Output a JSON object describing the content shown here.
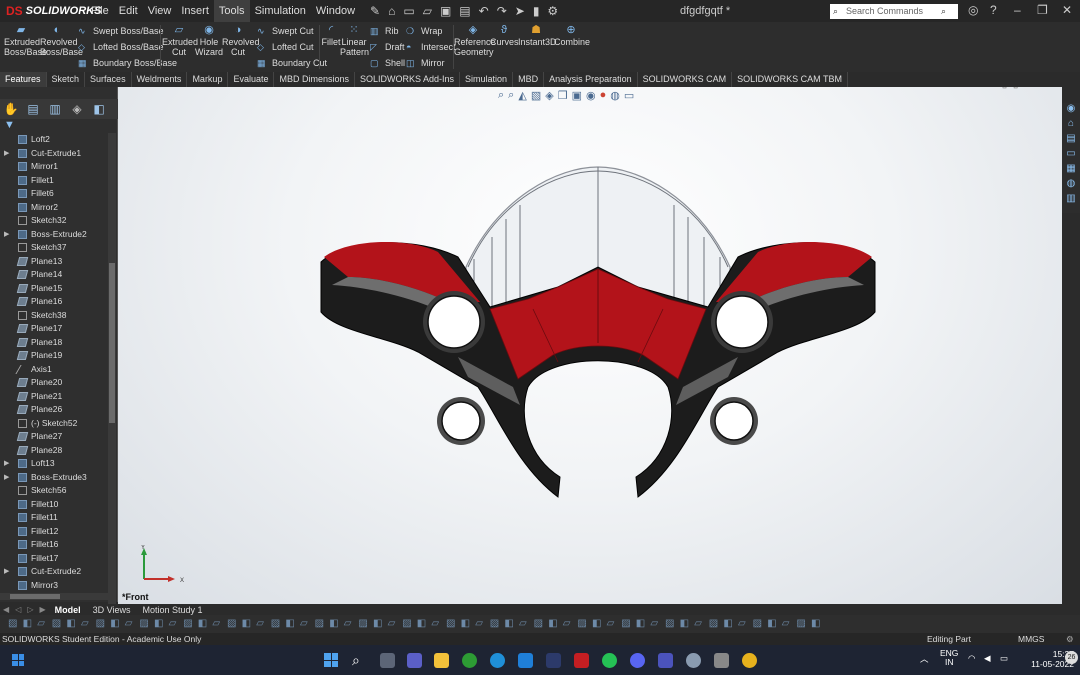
{
  "app": {
    "brand": "SOLIDWORKS",
    "brand_mark": "DS",
    "doc_title": "dfgdfgqtf *"
  },
  "menu": [
    "File",
    "Edit",
    "View",
    "Insert",
    "Tools",
    "Simulation",
    "Window"
  ],
  "search": {
    "placeholder": "Search Commands"
  },
  "cmd": {
    "extruded_boss": "Extruded Boss/Base",
    "revolved_boss": "Revolved Boss/Base",
    "swept_boss": "Swept Boss/Base",
    "lofted_boss": "Lofted Boss/Base",
    "boundary_boss": "Boundary Boss/Base",
    "extruded_cut": "Extruded Cut",
    "hole_wizard": "Hole Wizard",
    "revolved_cut": "Revolved Cut",
    "swept_cut": "Swept Cut",
    "lofted_cut": "Lofted Cut",
    "boundary_cut": "Boundary Cut",
    "fillet": "Fillet",
    "linear_pattern": "Linear Pattern",
    "rib": "Rib",
    "draft": "Draft",
    "shell": "Shell",
    "wrap": "Wrap",
    "intersect": "Intersect",
    "mirror": "Mirror",
    "reference_geometry": "Reference Geometry",
    "curves": "Curves",
    "instant3d": "Instant3D",
    "combine": "Combine"
  },
  "tabs": [
    "Features",
    "Sketch",
    "Surfaces",
    "Weldments",
    "Markup",
    "Evaluate",
    "MBD Dimensions",
    "SOLIDWORKS Add-Ins",
    "Simulation",
    "MBD",
    "Analysis Preparation",
    "SOLIDWORKS CAM",
    "SOLIDWORKS CAM TBM"
  ],
  "tree": [
    {
      "label": "Loft2",
      "expand": false,
      "kind": "feat"
    },
    {
      "label": "Cut-Extrude1",
      "expand": true,
      "kind": "feat"
    },
    {
      "label": "Mirror1",
      "expand": false,
      "kind": "feat"
    },
    {
      "label": "Fillet1",
      "expand": false,
      "kind": "feat"
    },
    {
      "label": "Fillet6",
      "expand": false,
      "kind": "feat"
    },
    {
      "label": "Mirror2",
      "expand": false,
      "kind": "feat"
    },
    {
      "label": "Sketch32",
      "expand": false,
      "kind": "sketch"
    },
    {
      "label": "Boss-Extrude2",
      "expand": true,
      "kind": "feat"
    },
    {
      "label": "Sketch37",
      "expand": false,
      "kind": "sketch"
    },
    {
      "label": "Plane13",
      "expand": false,
      "kind": "plane"
    },
    {
      "label": "Plane14",
      "expand": false,
      "kind": "plane"
    },
    {
      "label": "Plane15",
      "expand": false,
      "kind": "plane"
    },
    {
      "label": "Plane16",
      "expand": false,
      "kind": "plane"
    },
    {
      "label": "Sketch38",
      "expand": false,
      "kind": "sketch"
    },
    {
      "label": "Plane17",
      "expand": false,
      "kind": "plane"
    },
    {
      "label": "Plane18",
      "expand": false,
      "kind": "plane"
    },
    {
      "label": "Plane19",
      "expand": false,
      "kind": "plane"
    },
    {
      "label": "Axis1",
      "expand": false,
      "kind": "axis"
    },
    {
      "label": "Plane20",
      "expand": false,
      "kind": "plane"
    },
    {
      "label": "Plane21",
      "expand": false,
      "kind": "plane"
    },
    {
      "label": "Plane26",
      "expand": false,
      "kind": "plane"
    },
    {
      "label": "(-) Sketch52",
      "expand": false,
      "kind": "sketch"
    },
    {
      "label": "Plane27",
      "expand": false,
      "kind": "plane"
    },
    {
      "label": "Plane28",
      "expand": false,
      "kind": "plane"
    },
    {
      "label": "Loft13",
      "expand": true,
      "kind": "feat"
    },
    {
      "label": "Boss-Extrude3",
      "expand": true,
      "kind": "feat"
    },
    {
      "label": "Sketch56",
      "expand": false,
      "kind": "sketch"
    },
    {
      "label": "Fillet10",
      "expand": false,
      "kind": "feat"
    },
    {
      "label": "Fillet11",
      "expand": false,
      "kind": "feat"
    },
    {
      "label": "Fillet12",
      "expand": false,
      "kind": "feat"
    },
    {
      "label": "Fillet16",
      "expand": false,
      "kind": "feat"
    },
    {
      "label": "Fillet17",
      "expand": false,
      "kind": "feat"
    },
    {
      "label": "Cut-Extrude2",
      "expand": true,
      "kind": "feat"
    },
    {
      "label": "Mirror3",
      "expand": false,
      "kind": "feat"
    }
  ],
  "viewport": {
    "view_label": "*Front",
    "axis_y": "Y",
    "axis_x": "X"
  },
  "bottom_tabs": [
    "Model",
    "3D Views",
    "Motion Study 1"
  ],
  "status": {
    "left": "SOLIDWORKS Student Edition - Academic Use Only",
    "mode": "Editing Part",
    "units": "MMGS"
  },
  "tray": {
    "lang1": "ENG",
    "lang2": "IN",
    "time": "15:27",
    "date": "11-05-2022",
    "badge": "26"
  },
  "colors": {
    "model_red": "#b3131a",
    "model_black": "#1c1c1c",
    "accent": "#d22"
  }
}
